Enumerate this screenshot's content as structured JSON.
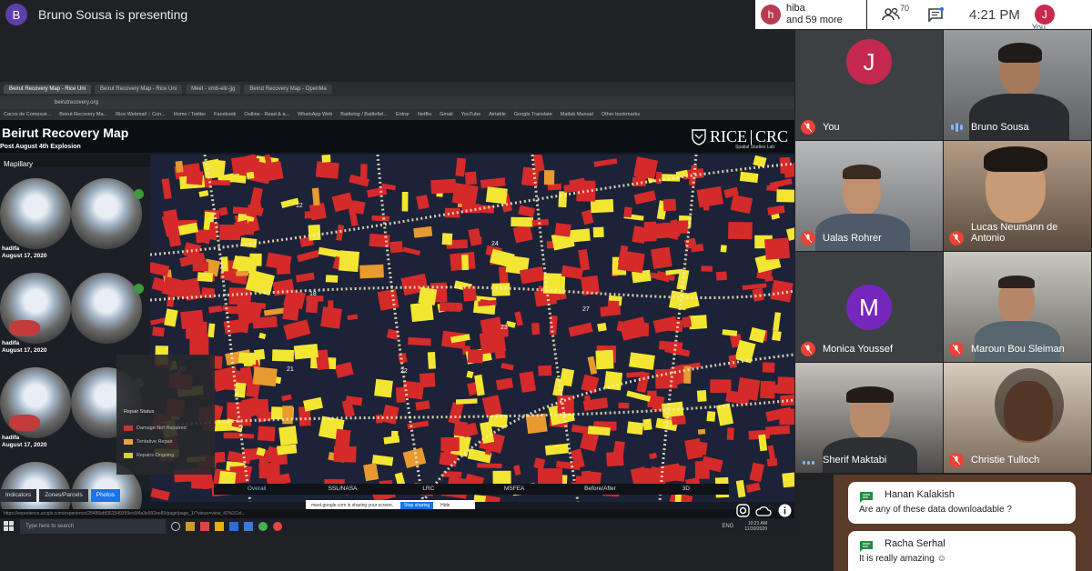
{
  "header": {
    "presenter_initial": "B",
    "presenter_text": "Bruno Sousa is presenting",
    "raised_initial": "h",
    "raised_name": "hiba",
    "raised_more": "and 59 more",
    "people_count": "70",
    "time": "4:21 PM",
    "self_initial": "J",
    "self_label": "You"
  },
  "presentation": {
    "tabs": [
      "Beirut Recovery Map - Rice Uni",
      "Beirut Recovery Map - Rice Uni",
      "Meet - vmb-eitr-jjg",
      "Beirut Recovery Map - OpenMa"
    ],
    "url": "beirutrecovery.org",
    "bookmarks": [
      "Cacos de Comexsir...",
      "Beirut Recovery Ma...",
      "Rice Webmail :: Con...",
      "Home / Twitter",
      "Facebook",
      "Outline - Read & a...",
      "WhatsApp Web",
      "Battlelog / Battlefiel...",
      "Entrar",
      "Netflix",
      "Gmail",
      "YouTube",
      "Airtable",
      "Google Translate",
      "Matlab Manual",
      "Other bookmarks"
    ],
    "title": "Beirut Recovery Map",
    "subtitle": "Post August 4th Explosion",
    "logo_left": "RICE",
    "logo_right": "CRC",
    "logo_sub": "Spatial Studies Lab",
    "panel_title": "Mapillary",
    "photo_entries": [
      {
        "name": "hadifa",
        "date": "August 17, 2020"
      },
      {
        "name": "hadifa",
        "date": "August 17, 2020"
      },
      {
        "name": "hadifa",
        "date": "August 17, 2020"
      }
    ],
    "legend": {
      "title": "Repair Status",
      "items": [
        {
          "label": "Damage Not Repaired",
          "color": "#c0392b"
        },
        {
          "label": "Tentative Repair",
          "color": "#e6a23c"
        },
        {
          "label": "Repairs Ongoing",
          "color": "#d4d433"
        }
      ]
    },
    "map_labels": [
      "12",
      "18",
      "16",
      "19",
      "20",
      "21",
      "22",
      "23",
      "24",
      "27"
    ],
    "bottom_tabs": [
      "Overall",
      "SSL/NASA",
      "LRC",
      "MSFEA",
      "Before/After",
      "3D"
    ],
    "panel_tabs": [
      "Indicators",
      "Zones/Parcels",
      "Photos"
    ],
    "share_text": "meet.google.com is sharing your screen.",
    "stop_label": "Stop sharing",
    "hide_label": "Hide",
    "status_url": "https://experience.arcgis.com/experience/28486afd361549359ec6f4a3e992ee89/page/page_1/?views=view_42%2Cst...",
    "search_placeholder": "Type here to search",
    "task_time": "10:21 AM",
    "task_date": "11/30/2020",
    "task_lang": "ENG"
  },
  "participants": [
    {
      "name": "You",
      "initial": "J",
      "avatar_color": "#c5294f",
      "muted": true
    },
    {
      "name": "Bruno Sousa",
      "muted": false
    },
    {
      "name": "Ualas Rohrer",
      "muted": true
    },
    {
      "name": "Lucas Neumann de Antonio",
      "muted": true
    },
    {
      "name": "Monica Youssef",
      "initial": "M",
      "avatar_color": "#7627bb",
      "muted": true
    },
    {
      "name": "Maroun Bou Sleiman",
      "muted": true
    },
    {
      "name": "Sherif Maktabi",
      "muted": false
    },
    {
      "name": "Christie Tulloch",
      "muted": true
    }
  ],
  "chat": [
    {
      "name": "Hanan Kalakish",
      "text": "Are any of these data downloadable ?"
    },
    {
      "name": "Racha Serhal",
      "text": "It is really amazing ☺"
    }
  ]
}
